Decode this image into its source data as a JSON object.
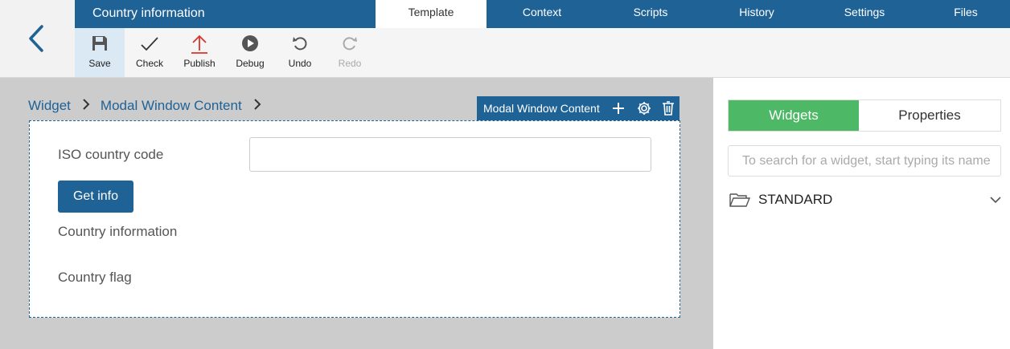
{
  "header": {
    "title": "Country information",
    "tabs": [
      {
        "label": "Template",
        "active": true
      },
      {
        "label": "Context",
        "active": false
      },
      {
        "label": "Scripts",
        "active": false
      },
      {
        "label": "History",
        "active": false
      },
      {
        "label": "Settings",
        "active": false
      },
      {
        "label": "Files",
        "active": false
      }
    ]
  },
  "toolbar": {
    "items": [
      {
        "label": "Save",
        "icon": "save-icon",
        "active": true
      },
      {
        "label": "Check",
        "icon": "check-icon"
      },
      {
        "label": "Publish",
        "icon": "upload-icon"
      },
      {
        "label": "Debug",
        "icon": "play-icon"
      },
      {
        "label": "Undo",
        "icon": "undo-icon"
      },
      {
        "label": "Redo",
        "icon": "redo-icon",
        "disabled": true
      }
    ]
  },
  "breadcrumb": {
    "items": [
      "Widget",
      "Modal Window Content"
    ]
  },
  "selected_widget": {
    "label": "Modal Window Content"
  },
  "form": {
    "iso_label": "ISO country code",
    "iso_value": "",
    "button_label": "Get info",
    "info_label": "Country information",
    "flag_label": "Country flag"
  },
  "right_panel": {
    "tabs": [
      {
        "label": "Widgets",
        "active": true
      },
      {
        "label": "Properties",
        "active": false
      }
    ],
    "search_placeholder": "To search for a widget, start typing its name",
    "group_name": "STANDARD"
  },
  "colors": {
    "primary": "#1f6296",
    "accent_green": "#4db865",
    "publish_red": "#d9342b",
    "canvas_gray": "#cccccc"
  }
}
